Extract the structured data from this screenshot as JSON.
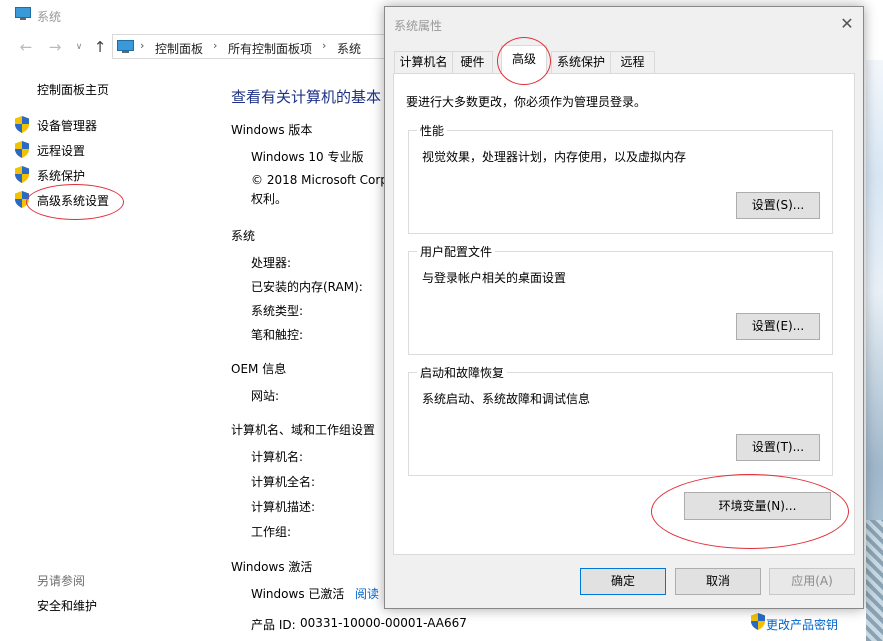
{
  "system_window": {
    "title": "系统",
    "nav": {
      "back_icon": "arrow-left-icon",
      "forward_icon": "arrow-right-icon",
      "recent_icon": "chevron-down-icon",
      "up_icon": "arrow-up-icon"
    },
    "breadcrumbs": [
      "控制面板",
      "所有控制面板项",
      "系统"
    ],
    "sidebar": {
      "home": "控制面板主页",
      "items": [
        "设备管理器",
        "远程设置",
        "系统保护",
        "高级系统设置"
      ],
      "see_also_label": "另请参阅",
      "see_also_items": [
        "安全和维护"
      ]
    },
    "heading": "查看有关计算机的基本",
    "windows_edition": {
      "label": "Windows 版本",
      "name": "Windows 10 专业版",
      "copyright_line1": "© 2018 Microsoft Corp",
      "copyright_line2": "权利。"
    },
    "system": {
      "label": "系统",
      "processor": "处理器:",
      "ram": "已安装的内存(RAM):",
      "type": "系统类型:",
      "pen": "笔和触控:"
    },
    "oem": {
      "label": "OEM 信息",
      "website": "网站:"
    },
    "computer_name": {
      "label": "计算机名、域和工作组设置",
      "name": "计算机名:",
      "full_name": "计算机全名:",
      "description": "计算机描述:",
      "workgroup": "工作组:"
    },
    "activation": {
      "label": "Windows 激活",
      "status": "Windows 已激活",
      "read_link": "阅读",
      "product_id_label": "产品 ID:",
      "product_id": "00331-10000-00001-AA667",
      "change_key_link": "更改产品密钥"
    }
  },
  "dialog": {
    "title": "系统属性",
    "close_icon": "close-icon",
    "tabs": [
      "计算机名",
      "硬件",
      "高级",
      "系统保护",
      "远程"
    ],
    "active_tab": "高级",
    "admin_note": "要进行大多数更改，你必须作为管理员登录。",
    "groups": [
      {
        "legend": "性能",
        "description": "视觉效果，处理器计划，内存使用，以及虚拟内存",
        "button": "设置(S)..."
      },
      {
        "legend": "用户配置文件",
        "description": "与登录帐户相关的桌面设置",
        "button": "设置(E)..."
      },
      {
        "legend": "启动和故障恢复",
        "description": "系统启动、系统故障和调试信息",
        "button": "设置(T)..."
      }
    ],
    "env_button": "环境变量(N)...",
    "ok": "确定",
    "cancel": "取消",
    "apply": "应用(A)"
  },
  "colors": {
    "annotation": "#e0303a",
    "link": "#0066cc",
    "heading": "#1e3287",
    "dialog_bg": "#f0f0f0"
  }
}
